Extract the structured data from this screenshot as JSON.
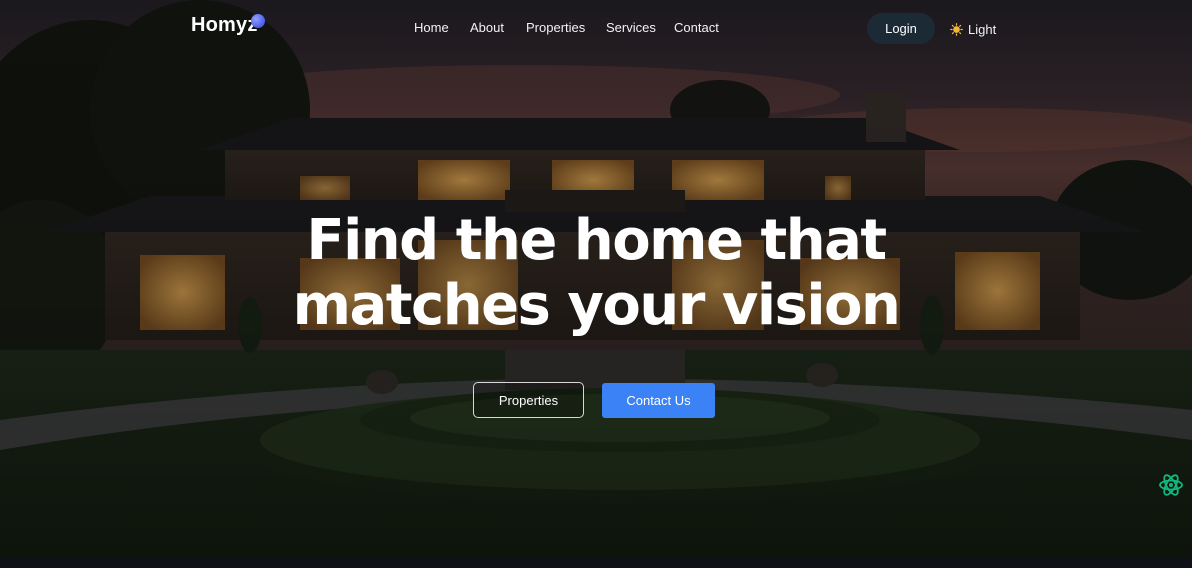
{
  "brand": {
    "name": "Homyz",
    "dot_color": "#4f5bea"
  },
  "nav": {
    "links": [
      {
        "label": "Home"
      },
      {
        "label": "About"
      },
      {
        "label": "Properties"
      },
      {
        "label": "Services"
      },
      {
        "label": "Contact"
      }
    ]
  },
  "header": {
    "login_label": "Login",
    "theme_label": "Light",
    "theme_icon": "sun-icon"
  },
  "hero": {
    "headline_line1": "Find the home that",
    "headline_line2": "matches your vision",
    "background_image": "house-at-dusk",
    "buttons": {
      "properties_label": "Properties",
      "contact_label": "Contact Us"
    }
  },
  "floating_widget": {
    "icon": "atom-icon",
    "color": "#10b981"
  },
  "colors": {
    "primary": "#3b82f6",
    "login_bg": "#1c2a36",
    "text": "#ffffff"
  }
}
